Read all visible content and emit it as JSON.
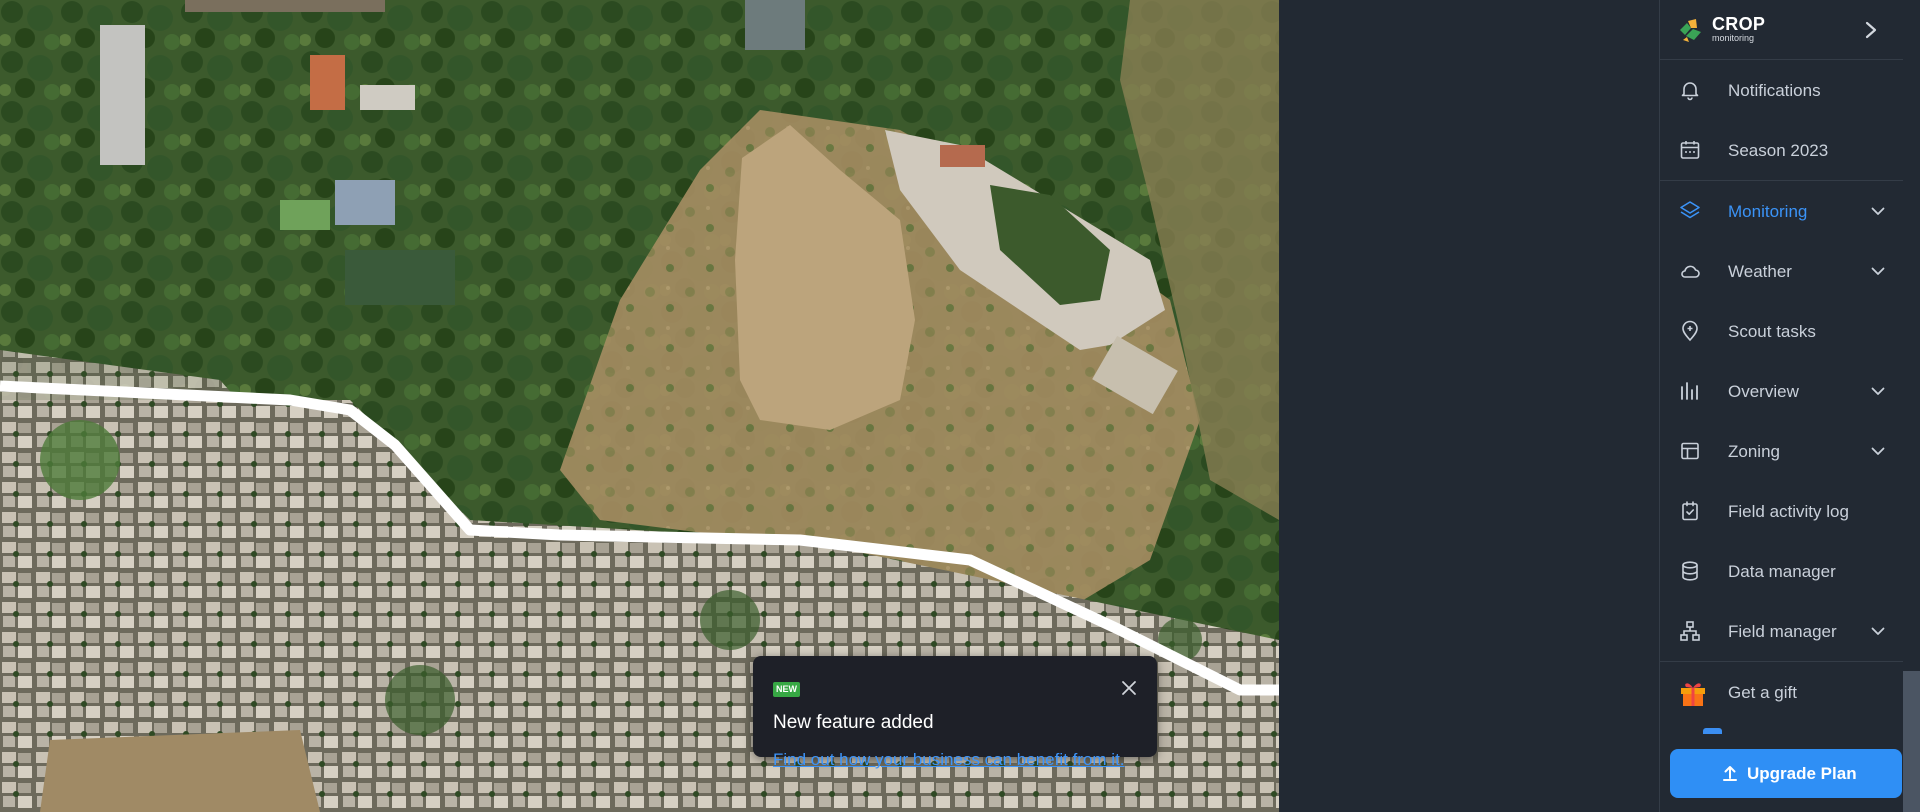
{
  "app": {
    "logo_text": "CROP",
    "logo_sub": "monitoring"
  },
  "sidebar": {
    "items": [
      {
        "label": "Notifications",
        "icon": "bell-icon",
        "has_chevron": false,
        "active": false
      },
      {
        "label": "Season 2023",
        "icon": "calendar-icon",
        "has_chevron": false,
        "active": false
      },
      {
        "label": "Monitoring",
        "icon": "layers-icon",
        "has_chevron": true,
        "active": true
      },
      {
        "label": "Weather",
        "icon": "cloud-icon",
        "has_chevron": true,
        "active": false
      },
      {
        "label": "Scout tasks",
        "icon": "map-pin-icon",
        "has_chevron": false,
        "active": false
      },
      {
        "label": "Overview",
        "icon": "bar-chart-icon",
        "has_chevron": true,
        "active": false
      },
      {
        "label": "Zoning",
        "icon": "layout-icon",
        "has_chevron": true,
        "active": false
      },
      {
        "label": "Field activity log",
        "icon": "clipboard-check-icon",
        "has_chevron": false,
        "active": false
      },
      {
        "label": "Data manager",
        "icon": "database-icon",
        "has_chevron": false,
        "active": false
      },
      {
        "label": "Field manager",
        "icon": "hierarchy-icon",
        "has_chevron": true,
        "active": false
      }
    ],
    "gift_label": "Get a gift",
    "upgrade_label": "Upgrade Plan"
  },
  "toast": {
    "badge": "NEW",
    "title": "New feature added",
    "link": "Find out how your business can benefit from it."
  },
  "colors": {
    "accent": "#3b93f7",
    "sidebar_bg": "#222933",
    "upgrade_bg": "#2f8ff5",
    "badge_green": "#37a844"
  }
}
